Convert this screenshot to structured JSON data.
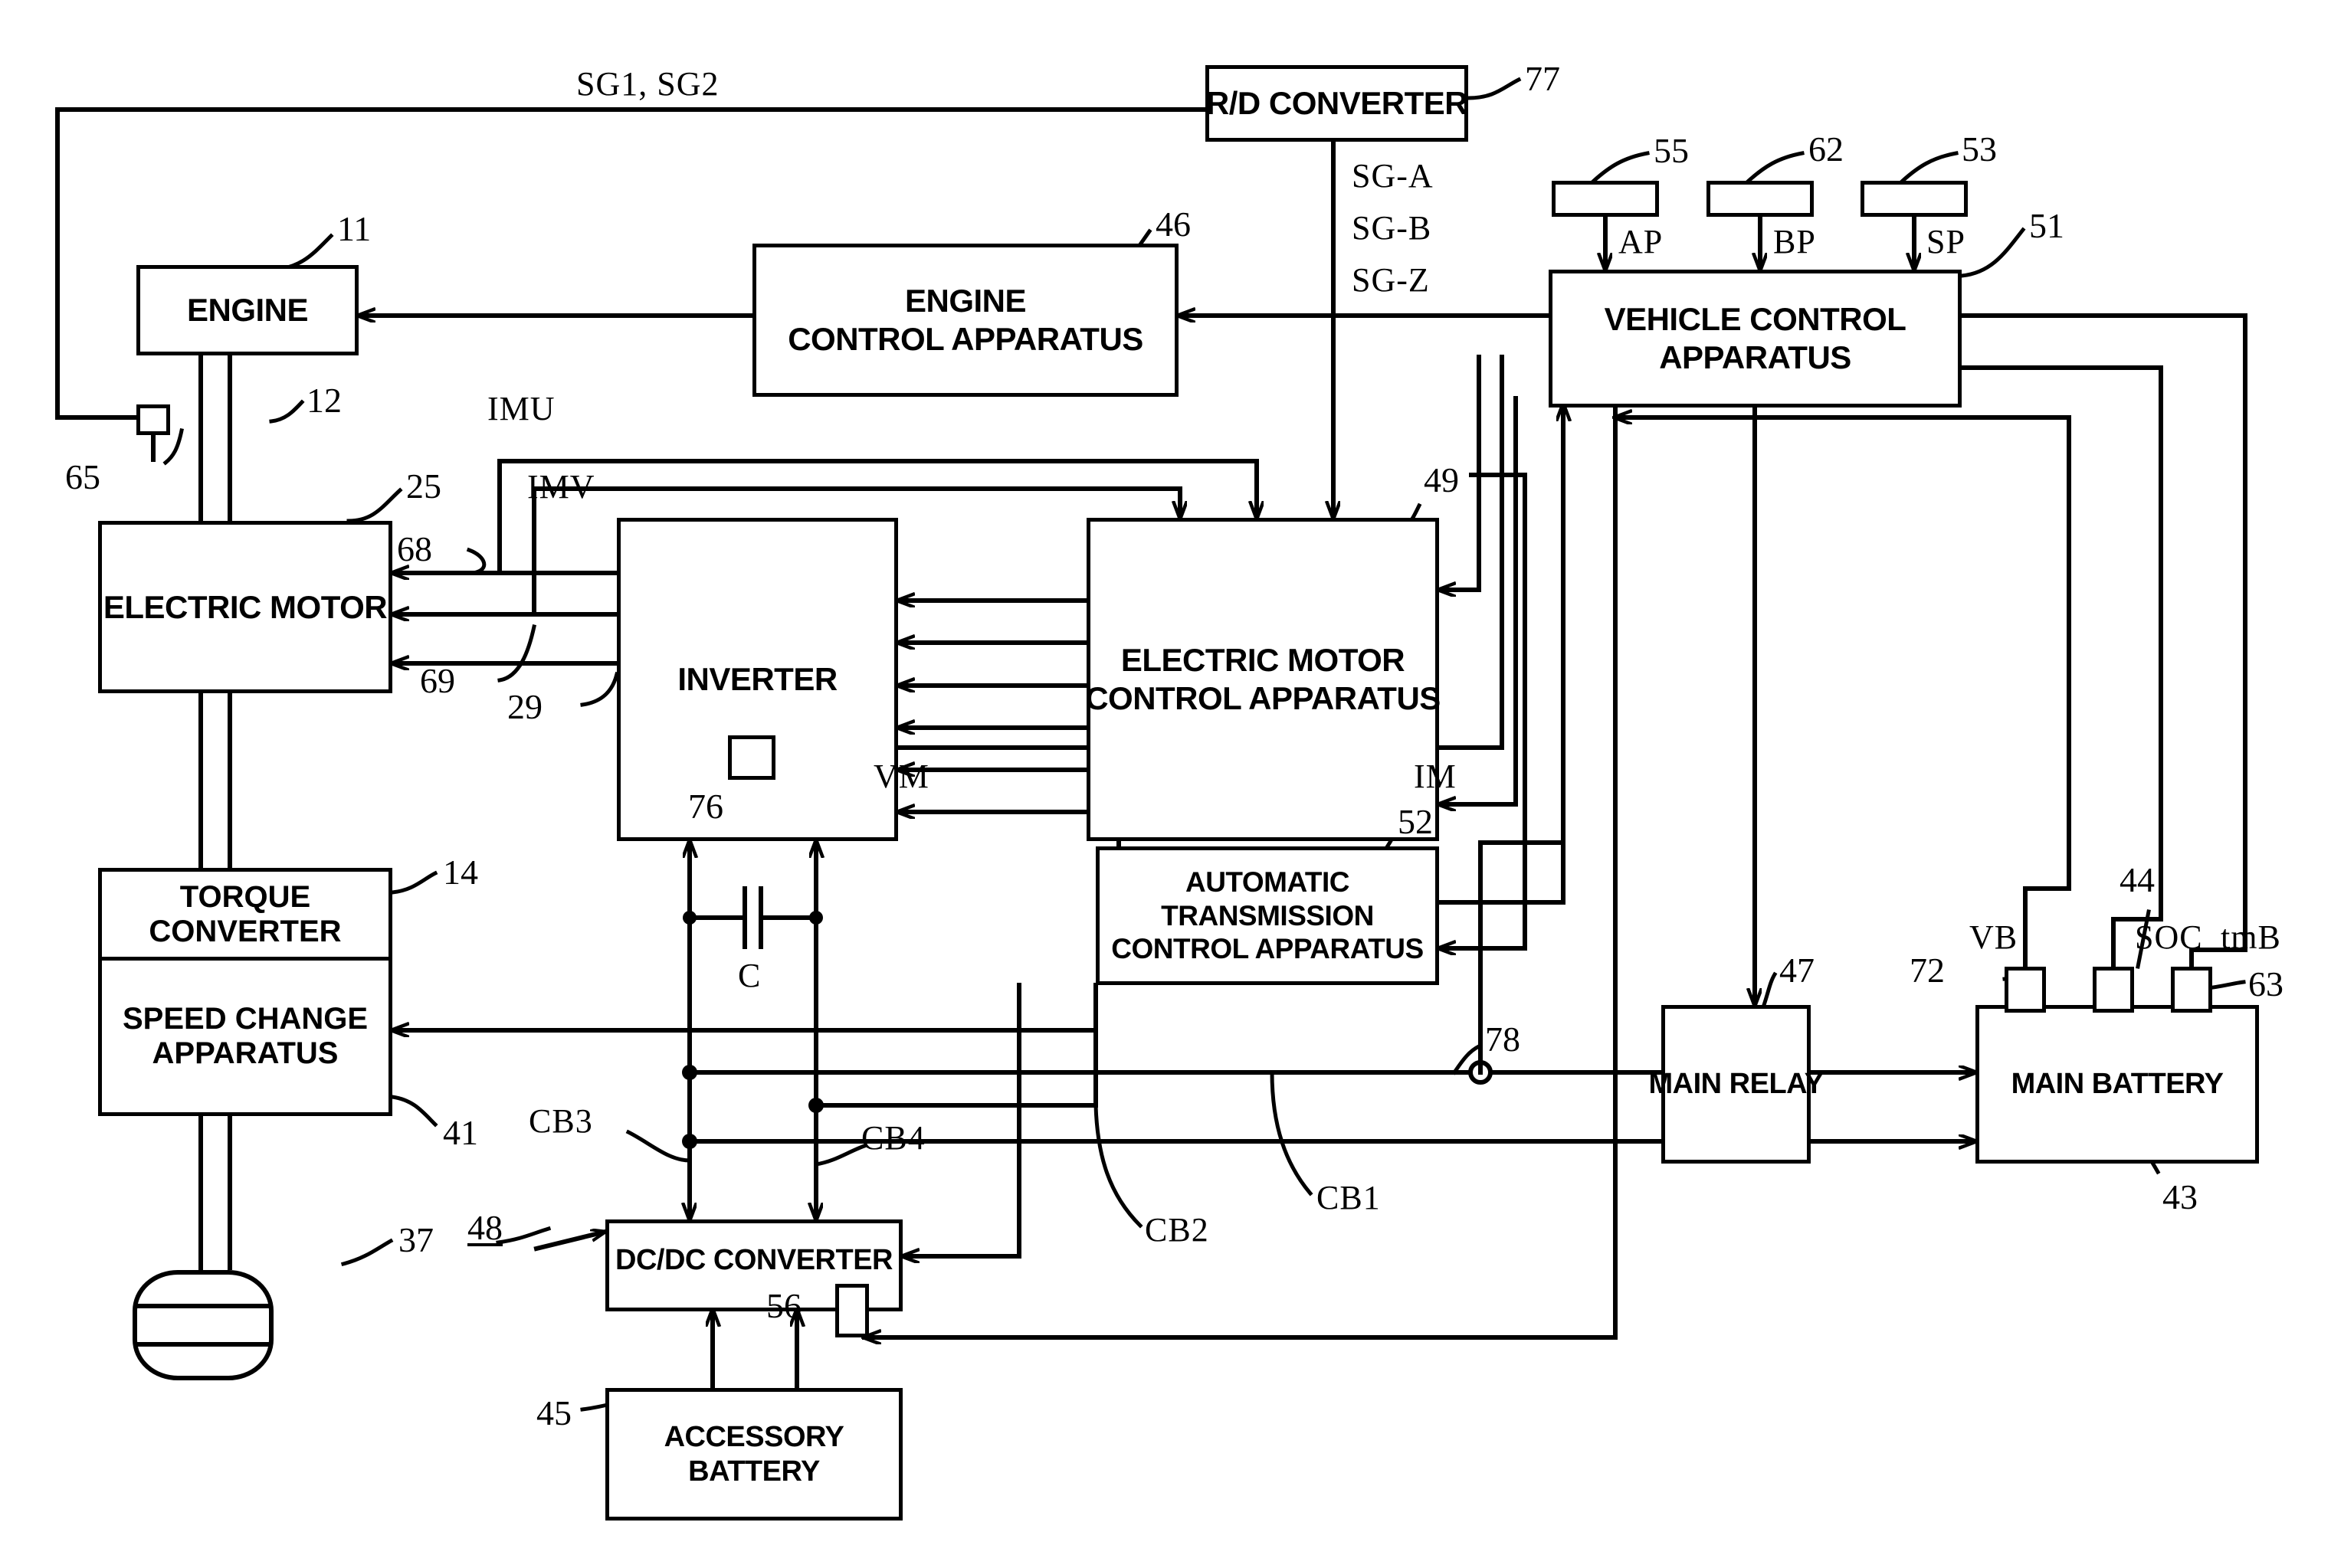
{
  "figure": {
    "type": "patent-block-diagram",
    "subject": "Hybrid vehicle drive control system block diagram"
  },
  "blocks": {
    "engine": {
      "label": "ENGINE",
      "ref": "11"
    },
    "engine_control": {
      "line1": "ENGINE",
      "line2": "CONTROL APPARATUS",
      "ref": "46"
    },
    "rd_converter": {
      "label": "R/D CONVERTER",
      "ref": "77"
    },
    "vehicle_control": {
      "line1": "VEHICLE CONTROL",
      "line2": "APPARATUS",
      "ref": "51"
    },
    "electric_motor": {
      "label": "ELECTRIC MOTOR",
      "ref": "25"
    },
    "inverter": {
      "label": "INVERTER",
      "ref": "29"
    },
    "motor_control": {
      "line1": "ELECTRIC MOTOR",
      "line2": "CONTROL APPARATUS",
      "ref": "49"
    },
    "torque_converter": {
      "line1": "TORQUE",
      "line2": "CONVERTER",
      "ref": "14"
    },
    "speed_change": {
      "line1": "SPEED CHANGE",
      "line2": "APPARATUS",
      "ref": "41"
    },
    "at_control": {
      "line1": "AUTOMATIC",
      "line2": "TRANSMISSION",
      "line3": "CONTROL APPARATUS",
      "ref": "52"
    },
    "main_relay": {
      "label": "MAIN RELAY",
      "ref": "47"
    },
    "main_battery": {
      "label": "MAIN BATTERY",
      "ref": "43"
    },
    "dcdc_converter": {
      "label": "DC/DC CONVERTER",
      "ref": "48"
    },
    "accessory_battery": {
      "line1": "ACCESSORY",
      "line2": "BATTERY",
      "ref": "45"
    }
  },
  "sensors": {
    "accel_pedal": {
      "ref": "55",
      "signal": "AP"
    },
    "brake_pedal": {
      "ref": "62",
      "signal": "BP"
    },
    "shift_position": {
      "ref": "53",
      "signal": "SP"
    },
    "engine_speed": {
      "ref": "65"
    },
    "battery_voltage": {
      "ref": "72",
      "signal": "VB"
    },
    "battery_soc": {
      "ref": "44",
      "signal": "SOC"
    },
    "battery_temp": {
      "ref": "63",
      "signal": "tmB"
    },
    "inverter_voltage": {
      "ref": "76",
      "signal": "VM"
    },
    "motor_current_u": {
      "ref": "68"
    },
    "motor_current_v": {
      "ref": "69"
    },
    "dcdc_sensor": {
      "ref": "56"
    },
    "current_node": {
      "ref": "78"
    }
  },
  "signals": {
    "sg1_sg2": "SG1, SG2",
    "sg_a": "SG-A",
    "sg_b": "SG-B",
    "sg_z": "SG-Z",
    "imu": "IMU",
    "imv": "IMV",
    "vm": "VM",
    "im": "IM",
    "ap": "AP",
    "bp": "BP",
    "sp": "SP",
    "vb": "VB",
    "soc": "SOC",
    "tmb": "tmB",
    "capacitor": "C",
    "cb1": "CB1",
    "cb2": "CB2",
    "cb3": "CB3",
    "cb4": "CB4"
  },
  "reference_numerals": {
    "drive_shaft": "12",
    "wheel": "37",
    "engine": "11",
    "torque_converter": "14",
    "electric_motor": "25",
    "inverter": "29",
    "speed_change": "41",
    "main_battery": "43",
    "battery_soc": "44",
    "accessory_battery": "45",
    "engine_control": "46",
    "main_relay": "47",
    "dcdc_converter": "48",
    "motor_control": "49",
    "vehicle_control": "51",
    "at_control": "52",
    "shift_sensor": "53",
    "accel_sensor": "55",
    "dcdc_sensor": "56",
    "brake_sensor": "62",
    "battery_temp": "63",
    "engine_sensor": "65",
    "imu_sensor": "68",
    "imv_sensor": "69",
    "battery_volt": "72",
    "inverter_volt_sensor": "76",
    "rd_converter": "77",
    "current_node": "78"
  },
  "colors": {
    "line": "#000000",
    "background": "#ffffff"
  }
}
